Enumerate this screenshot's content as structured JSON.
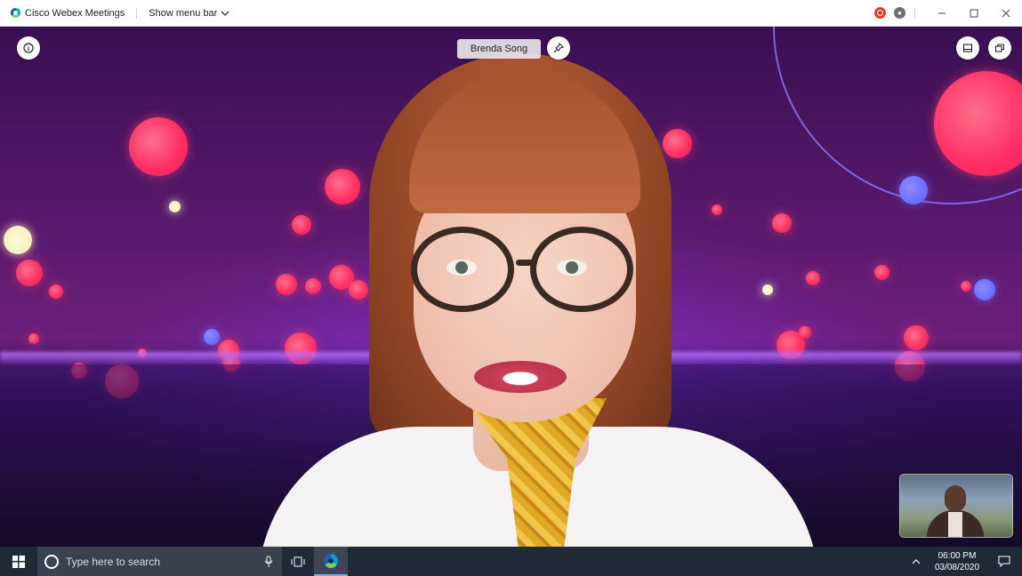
{
  "window": {
    "title": "Cisco Webex Meetings",
    "menu_toggle_label": "Show menu bar",
    "icons": {
      "app": "webex-logo-icon",
      "menu_chevron": "chevron-down-icon",
      "recording": "recording-icon",
      "security": "lock-icon",
      "minimize": "minimize-icon",
      "maximize": "maximize-icon",
      "close": "close-icon"
    }
  },
  "meeting": {
    "active_speaker_name": "Brenda Song",
    "controls": {
      "info": "info-icon",
      "pin": "pin-icon",
      "layout": "layout-icon",
      "popout": "popout-icon"
    },
    "self_view_icon": "self-view-icon"
  },
  "taskbar": {
    "search_placeholder": "Type here to search",
    "time": "06:00 PM",
    "date": "03/08/2020",
    "icons": {
      "start": "windows-start-icon",
      "search": "cortana-icon",
      "mic": "microphone-icon",
      "task_view": "task-view-icon",
      "webex": "webex-app-icon",
      "tray_up": "chevron-up-icon",
      "notifications": "notification-icon"
    }
  },
  "colors": {
    "title_bar_bg": "#ffffff",
    "recording_red": "#e2372c",
    "taskbar_bg": "#1f2a36",
    "taskbar_search_bg": "#39424d",
    "active_app_underline": "#6fb0e6"
  }
}
